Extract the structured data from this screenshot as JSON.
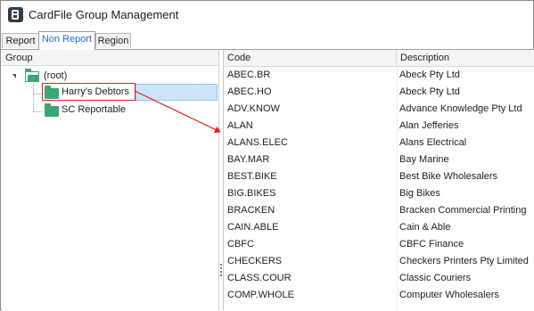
{
  "window": {
    "title": "CardFile Group Management",
    "icon": "cardfile-app-icon"
  },
  "tabs": [
    {
      "label": "Report",
      "active": false
    },
    {
      "label": "Non Report",
      "active": true
    },
    {
      "label": "Region",
      "active": false
    }
  ],
  "left_panel": {
    "header": "Group",
    "tree": {
      "root_label": "(root)",
      "children": [
        {
          "label": "Harry's Debtors",
          "selected": true,
          "highlighted": true
        },
        {
          "label": "SC Reportable",
          "selected": false,
          "highlighted": false
        }
      ]
    }
  },
  "grid": {
    "columns": [
      "Code",
      "Description"
    ],
    "rows": [
      {
        "code": "ABEC.BR",
        "description": "Abeck Pty Ltd"
      },
      {
        "code": "ABEC.HO",
        "description": "Abeck Pty Ltd"
      },
      {
        "code": "ADV.KNOW",
        "description": "Advance Knowledge Pty Ltd"
      },
      {
        "code": "ALAN",
        "description": "Alan Jefferies"
      },
      {
        "code": "ALANS.ELEC",
        "description": "Alans Electrical"
      },
      {
        "code": "BAY.MAR",
        "description": "Bay Marine"
      },
      {
        "code": "BEST.BIKE",
        "description": "Best Bike Wholesalers"
      },
      {
        "code": "BIG.BIKES",
        "description": "Big Bikes"
      },
      {
        "code": "BRACKEN",
        "description": "Bracken Commercial Printing"
      },
      {
        "code": "CAIN.ABLE",
        "description": "Cain & Able"
      },
      {
        "code": "CBFC",
        "description": "CBFC Finance"
      },
      {
        "code": "CHECKERS",
        "description": "Checkers Printers Pty Limited"
      },
      {
        "code": "CLASS.COUR",
        "description": "Classic Couriers"
      },
      {
        "code": "COMP.WHOLE",
        "description": "Computer Wholesalers"
      }
    ]
  },
  "colors": {
    "annotation": "#e02020",
    "folder": "#3aa776",
    "selection": "#cce4f7",
    "active_tab_text": "#2b6cc1"
  }
}
